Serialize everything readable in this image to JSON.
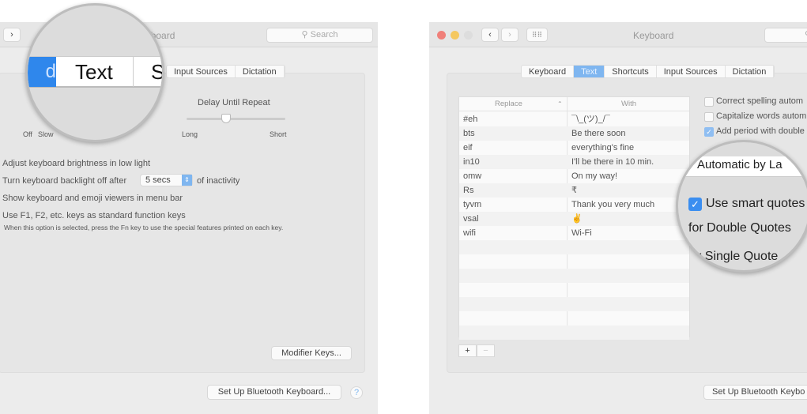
{
  "left_window": {
    "title": "Keyboard",
    "search_placeholder": "Search",
    "tabs": [
      "Input Sources",
      "Dictation"
    ],
    "magnifier": {
      "tab_prev": "d",
      "tab_text": "Text",
      "tab_next": "S"
    },
    "key_repeat": {
      "labels": [
        "Off",
        "Slow"
      ]
    },
    "delay_until_repeat": {
      "title": "Delay Until Repeat",
      "min": "Long",
      "max": "Short",
      "value": 0.33
    },
    "options": {
      "brightness": "Adjust keyboard brightness in low light",
      "backlight_before": "Turn keyboard backlight off after",
      "backlight_value": "5 secs",
      "backlight_after": "of inactivity",
      "show_viewers": "Show keyboard and emoji viewers in menu bar",
      "fn_keys": "Use F1, F2, etc. keys as standard function keys",
      "fn_note": "When this option is selected, press the Fn key to use the special features printed on each key."
    },
    "modifier_keys": "Modifier Keys...",
    "bluetooth": "Set Up Bluetooth Keyboard...",
    "help": "?"
  },
  "right_window": {
    "title": "Keyboard",
    "tabs": [
      "Keyboard",
      "Text",
      "Shortcuts",
      "Input Sources",
      "Dictation"
    ],
    "selected_tab": "Text",
    "table": {
      "headers": [
        "Replace",
        "With"
      ],
      "rows": [
        [
          "#eh",
          "¯\\_(ツ)_/¯"
        ],
        [
          "bts",
          "Be there soon"
        ],
        [
          "eif",
          "everything's fine"
        ],
        [
          "in10",
          "I'll be there in 10 min."
        ],
        [
          "omw",
          "On my way!"
        ],
        [
          "Rs",
          "₹"
        ],
        [
          "tyvm",
          "Thank you very much"
        ],
        [
          "vsal",
          "✌"
        ],
        [
          "wifi",
          "Wi-Fi"
        ]
      ]
    },
    "add": "+",
    "remove": "−",
    "checkboxes": [
      {
        "label": "Correct spelling autom",
        "checked": false
      },
      {
        "label": "Capitalize words autom",
        "checked": false
      },
      {
        "label": "Add period with double",
        "checked": true
      }
    ],
    "magnifier": {
      "spelling": "Automatic by La",
      "smart_quotes": "Use smart quotes",
      "double": "for Double Quotes",
      "single": "r Single Quote"
    },
    "bluetooth": "Set Up Bluetooth Keybo",
    "accent": "#3b8ef0"
  }
}
